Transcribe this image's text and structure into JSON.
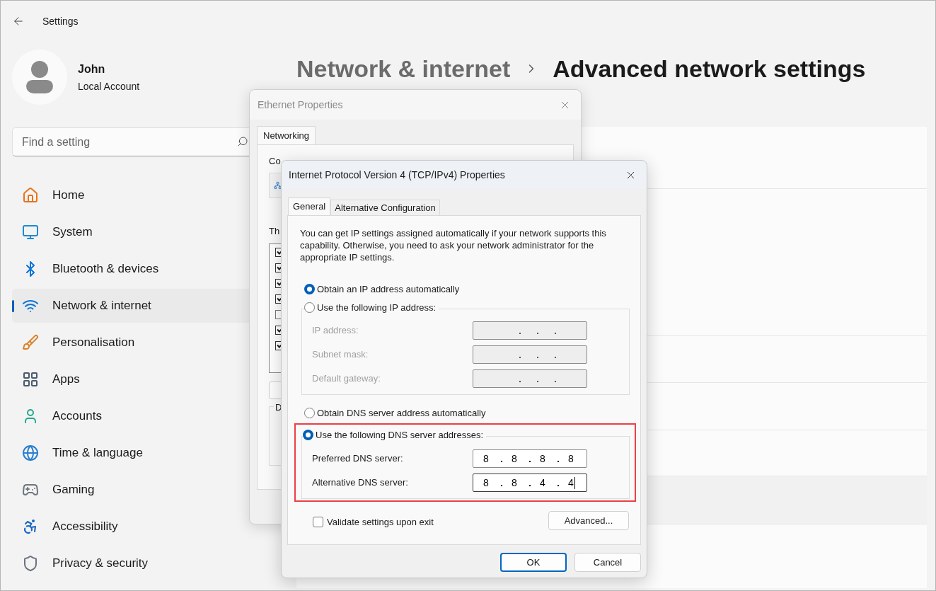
{
  "window": {
    "title": "Settings"
  },
  "profile": {
    "name": "John",
    "account": "Local Account"
  },
  "search": {
    "placeholder": "Find a setting"
  },
  "sidebar": {
    "items": [
      {
        "kind": "home",
        "label": "Home",
        "selected": false
      },
      {
        "kind": "system",
        "label": "System",
        "selected": false
      },
      {
        "kind": "bluetooth",
        "label": "Bluetooth & devices",
        "selected": false
      },
      {
        "kind": "network",
        "label": "Network & internet",
        "selected": true
      },
      {
        "kind": "personalisation",
        "label": "Personalisation",
        "selected": false
      },
      {
        "kind": "apps",
        "label": "Apps",
        "selected": false
      },
      {
        "kind": "accounts",
        "label": "Accounts",
        "selected": false
      },
      {
        "kind": "time",
        "label": "Time & language",
        "selected": false
      },
      {
        "kind": "gaming",
        "label": "Gaming",
        "selected": false
      },
      {
        "kind": "accessibility",
        "label": "Accessibility",
        "selected": false
      },
      {
        "kind": "privacy",
        "label": "Privacy & security",
        "selected": false
      }
    ]
  },
  "breadcrumb": [
    {
      "label": "Network & internet",
      "current": false
    },
    {
      "label": "Advanced network settings",
      "current": true
    }
  ],
  "ethernet_dialog": {
    "title": "Ethernet Properties",
    "tabs": [
      {
        "label": "Networking",
        "selected": true
      }
    ],
    "connect_label": "Co",
    "items_label": "Th",
    "group_label": "D",
    "components": [
      {
        "checked": true
      },
      {
        "checked": true
      },
      {
        "checked": true
      },
      {
        "checked": true
      },
      {
        "checked": false
      },
      {
        "checked": true
      },
      {
        "checked": true
      }
    ]
  },
  "ipv4_dialog": {
    "title": "Internet Protocol Version 4 (TCP/IPv4) Properties",
    "tabs": [
      {
        "label": "General",
        "selected": true
      },
      {
        "label": "Alternative Configuration",
        "selected": false
      }
    ],
    "description": "You can get IP settings assigned automatically if your network supports this capability. Otherwise, you need to ask your network administrator for the appropriate IP settings.",
    "ip_auto": {
      "label": "Obtain an IP address automatically",
      "selected": true
    },
    "ip_manual": {
      "label": "Use the following IP address:",
      "selected": false
    },
    "ip_fields": [
      {
        "label": "IP address:",
        "disabled": true
      },
      {
        "label": "Subnet mask:",
        "disabled": true
      },
      {
        "label": "Default gateway:",
        "disabled": true
      }
    ],
    "dns_auto": {
      "label": "Obtain DNS server address automatically",
      "selected": false
    },
    "dns_manual": {
      "label": "Use the following DNS server addresses:",
      "selected": true
    },
    "dns_highlighted": true,
    "dns_fields": [
      {
        "label": "Preferred DNS server:",
        "disabled": false,
        "focused": false,
        "octets": [
          "8",
          "8",
          "8",
          "8"
        ]
      },
      {
        "label": "Alternative DNS server:",
        "disabled": false,
        "focused": true,
        "octets": [
          "8",
          "8",
          "4",
          "4"
        ]
      }
    ],
    "validate": {
      "label": "Validate settings upon exit",
      "checked": false
    },
    "advanced_button": "Advanced...",
    "buttons": [
      {
        "label": "OK",
        "default": true
      },
      {
        "label": "Cancel",
        "default": false
      }
    ]
  }
}
